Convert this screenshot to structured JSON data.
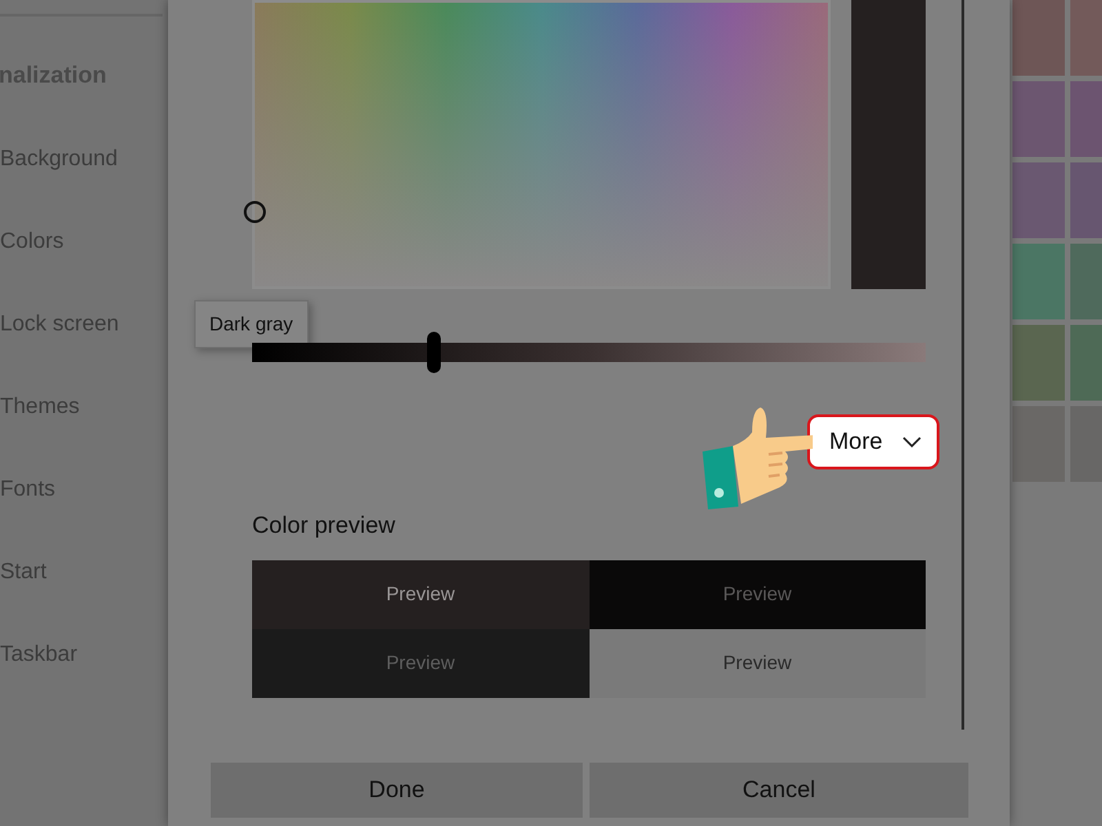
{
  "sidebar": {
    "heading": "nalization",
    "items": [
      {
        "label": "Background"
      },
      {
        "label": "Colors"
      },
      {
        "label": "Lock screen"
      },
      {
        "label": "Themes"
      },
      {
        "label": "Fonts"
      },
      {
        "label": "Start"
      },
      {
        "label": "Taskbar"
      }
    ]
  },
  "dialog": {
    "tooltip": "Dark gray",
    "brightness": {
      "level": 0.27
    },
    "more_button": "More",
    "preview_title": "Color preview",
    "preview_cells": [
      {
        "label": "Preview",
        "color": "#252020"
      },
      {
        "label": "Preview",
        "color": "#0a0909"
      },
      {
        "label": "Preview",
        "color": "#1b1b1b"
      },
      {
        "label": "Preview",
        "color": "#7a7a7a"
      }
    ],
    "buttons": [
      "Done",
      "Cancel"
    ]
  },
  "swatches": [
    {
      "color": "#6e5656"
    },
    {
      "color": "#735a5a"
    },
    {
      "color": "#6c5670"
    },
    {
      "color": "#6c5470"
    },
    {
      "color": "#6a5871"
    },
    {
      "color": "#675670"
    },
    {
      "color": "#4b7664"
    },
    {
      "color": "#4f6a5c"
    },
    {
      "color": "#5a6650"
    },
    {
      "color": "#4e6a56"
    },
    {
      "color": "#6a6866"
    },
    {
      "color": "#686766"
    }
  ]
}
